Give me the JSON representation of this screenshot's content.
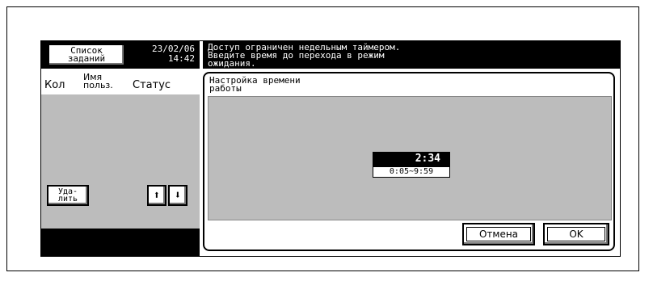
{
  "header": {
    "jobs_button_line1": "Список",
    "jobs_button_line2": "заданий",
    "date": "23/02/06",
    "time": "14:42"
  },
  "message": {
    "line1": "Доступ ограничен недельным таймером.",
    "line2": "Введите время до перехода в режим",
    "line3": "ожидания."
  },
  "job_list": {
    "col_count": "Кол",
    "col_user_line1": "Имя",
    "col_user_line2": "польз.",
    "col_status": "Статус",
    "delete_line1": "Уда-",
    "delete_line2": "лить",
    "up_icon": "arrow-up-icon",
    "down_icon": "arrow-down-icon"
  },
  "settings": {
    "title_line1": "Настройка времени",
    "title_line2": "работы",
    "time_value": "2:34",
    "range": "0:05~9:59",
    "cancel_label": "Отмена",
    "ok_label": "OK"
  }
}
